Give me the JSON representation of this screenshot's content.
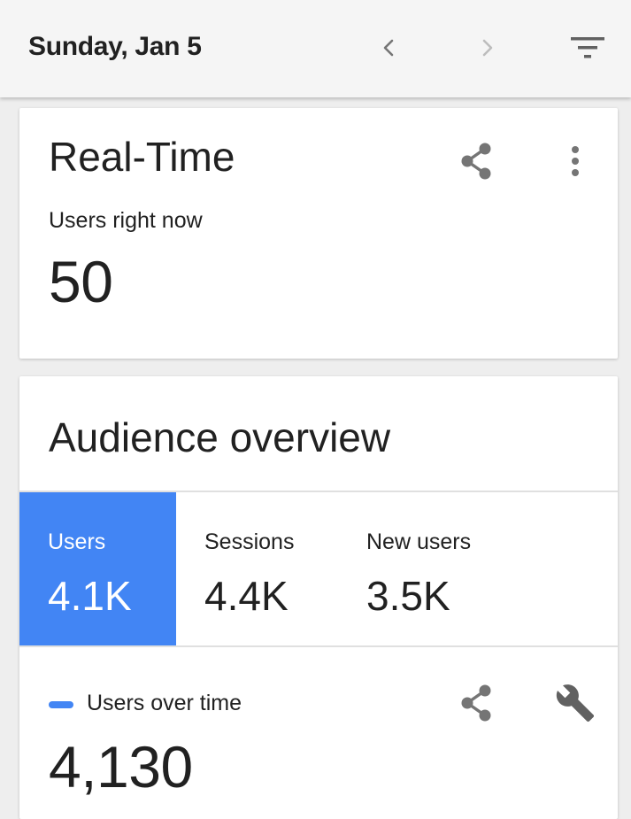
{
  "topbar": {
    "date": "Sunday, Jan 5",
    "prev_icon": "chevron-left-icon",
    "next_icon": "chevron-right-icon",
    "filter_icon": "filter-icon"
  },
  "realtime": {
    "title": "Real-Time",
    "share_icon": "share-icon",
    "menu_icon": "more-vert-icon",
    "metric_label": "Users right now",
    "metric_value": "50"
  },
  "audience": {
    "title": "Audience overview",
    "tabs": [
      {
        "label": "Users",
        "value": "4.1K",
        "active": true
      },
      {
        "label": "Sessions",
        "value": "4.4K",
        "active": false
      },
      {
        "label": "New users",
        "value": "3.5K",
        "active": false
      }
    ],
    "series_label": "Users over time",
    "series_color": "#4285f4",
    "series_total": "4,130",
    "share_icon": "share-icon",
    "customize_icon": "wrench-icon"
  },
  "colors": {
    "accent": "#4285f4",
    "text": "#212121",
    "icon": "#757575"
  }
}
